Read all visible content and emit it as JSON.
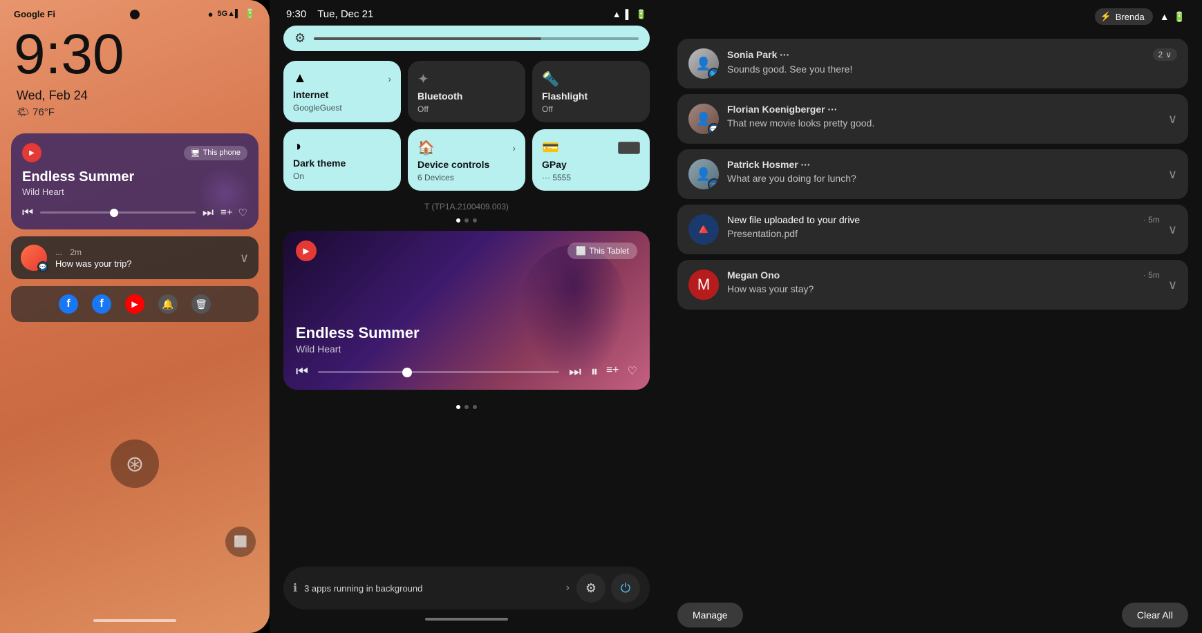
{
  "phone": {
    "carrier": "Google Fi",
    "network": "5G",
    "time": "9:30",
    "date": "Wed, Feb 24",
    "weather": "76°F",
    "weather_icon": "🌤",
    "this_phone_label": "This phone",
    "music": {
      "title": "Endless Summer",
      "subtitle": "Wild Heart",
      "play_icon": "▶",
      "pause_icon": "⏸",
      "prev_icon": "⏮",
      "next_icon": "⏭"
    },
    "notification": {
      "sender": "...",
      "time": "2m",
      "message": "How was your trip?"
    },
    "fingerprint_icon": "⊛",
    "recents_icon": "⬜"
  },
  "quick_settings": {
    "time": "9:30",
    "date": "Tue, Dec 21",
    "brightness_icon": "⚙",
    "tiles": [
      {
        "icon": "▲",
        "label": "Internet",
        "sublabel": "GoogleGuest",
        "active": true,
        "has_arrow": true
      },
      {
        "icon": "🔵",
        "label": "Bluetooth",
        "sublabel": "Off",
        "active": false,
        "has_arrow": false
      },
      {
        "icon": "🔦",
        "label": "Flashlight",
        "sublabel": "Off",
        "active": false,
        "has_arrow": false
      },
      {
        "icon": "◑",
        "label": "Dark theme",
        "sublabel": "On",
        "active": true,
        "has_arrow": false
      },
      {
        "icon": "🔒",
        "label": "Device controls",
        "sublabel": "6 Devices",
        "active": true,
        "has_arrow": true
      },
      {
        "icon": "💳",
        "label": "GPay",
        "sublabel": "··· 5555",
        "active": true,
        "has_arrow": false
      }
    ],
    "build_number": "T (TP1A.2100409.003)",
    "this_tablet_label": "This Tablet",
    "music": {
      "title": "Endless Summer",
      "subtitle": "Wild Heart"
    },
    "bg_apps": "3 apps running in background",
    "settings_icon": "⚙",
    "power_icon": "⏻"
  },
  "notifications": {
    "brenda_label": "Brenda",
    "items": [
      {
        "id": "sonia",
        "sender": "Sonia Park ···",
        "message": "Sounds good. See you there!",
        "count": "2",
        "has_avatar": true,
        "avatar_type": "person1",
        "has_badge": true
      },
      {
        "id": "florian",
        "sender": "Florian Koenigberger ···",
        "message": "That new movie looks pretty good.",
        "count": null,
        "has_avatar": true,
        "avatar_type": "person2",
        "has_badge": true
      },
      {
        "id": "patrick",
        "sender": "Patrick Hosmer ···",
        "message": "What are you doing for lunch?",
        "count": null,
        "has_avatar": true,
        "avatar_type": "person3",
        "has_badge": true
      },
      {
        "id": "drive",
        "sender": "New file uploaded to your drive",
        "time": "5m",
        "message": "Presentation.pdf",
        "count": null,
        "has_avatar": false,
        "icon_type": "drive"
      },
      {
        "id": "megan",
        "sender": "Megan Ono",
        "time": "5m",
        "message": "How was your stay?",
        "count": null,
        "has_avatar": false,
        "icon_type": "megan"
      }
    ],
    "manage_label": "Manage",
    "clear_all_label": "Clear All"
  }
}
